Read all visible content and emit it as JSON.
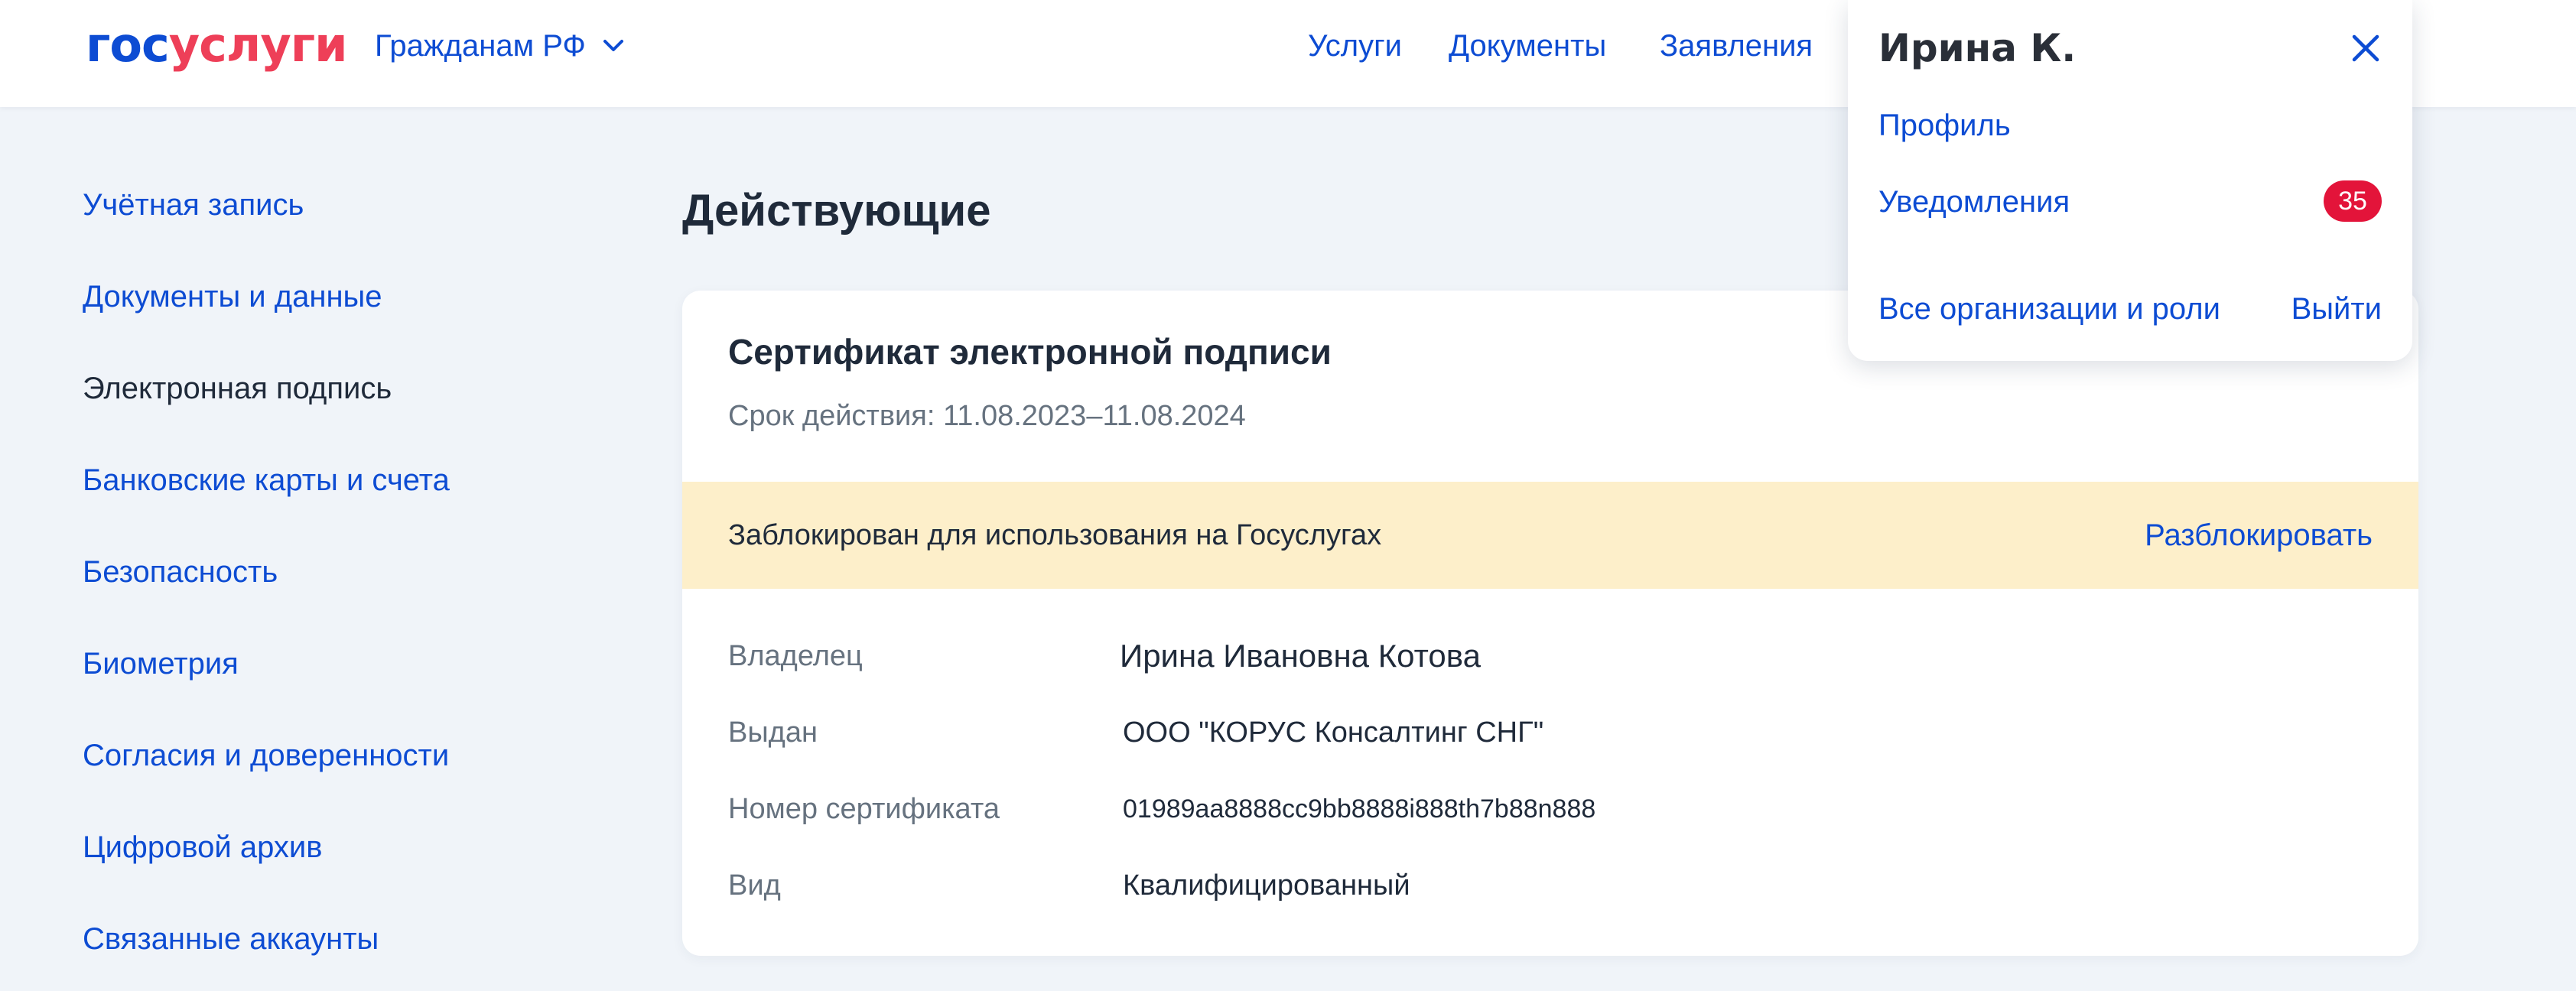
{
  "header": {
    "logo_part1": "гос",
    "logo_part2": "услуги",
    "region_label": "Гражданам РФ",
    "nav": {
      "services": "Услуги",
      "documents": "Документы",
      "requests": "Заявления"
    }
  },
  "sidebar": {
    "items": [
      {
        "label": "Учётная запись"
      },
      {
        "label": "Документы и данные"
      },
      {
        "label": "Электронная подпись"
      },
      {
        "label": "Банковские карты и счета"
      },
      {
        "label": "Безопасность"
      },
      {
        "label": "Биометрия"
      },
      {
        "label": "Согласия и доверенности"
      },
      {
        "label": "Цифровой архив"
      },
      {
        "label": "Связанные аккаунты"
      }
    ],
    "active_index": 2
  },
  "main": {
    "title": "Действующие",
    "certificate": {
      "title": "Сертификат электронной подписи",
      "validity_label": "Срок действия:",
      "validity_dates": "11.08.2023–11.08.2024",
      "warning_text": "Заблокирован для использования на Госуслугах",
      "unblock_label": "Разблокировать",
      "details": [
        {
          "label": "Владелец",
          "value": "Ирина Ивановна Котова"
        },
        {
          "label": "Выдан",
          "value": "ООО \"КОРУС Консалтинг СНГ\""
        },
        {
          "label": "Номер сертификата",
          "value": "01989aa8888cc9bb8888i888th7b88n888"
        },
        {
          "label": "Вид",
          "value": "Квалифицированный"
        }
      ]
    }
  },
  "profile_menu": {
    "username": "Ирина К.",
    "profile_label": "Профиль",
    "notifications_label": "Уведомления",
    "notifications_count": "35",
    "orgs_label": "Все организации и роли",
    "logout_label": "Выйти"
  },
  "colors": {
    "link": "#0d4cd3",
    "brand_red": "#ee3f58",
    "badge": "#e3143a",
    "warning_bg": "#fdefca",
    "page_bg": "#f0f4f9"
  },
  "icons": {
    "region_toggle": "chevron-down-icon",
    "menu_close": "close-icon"
  }
}
